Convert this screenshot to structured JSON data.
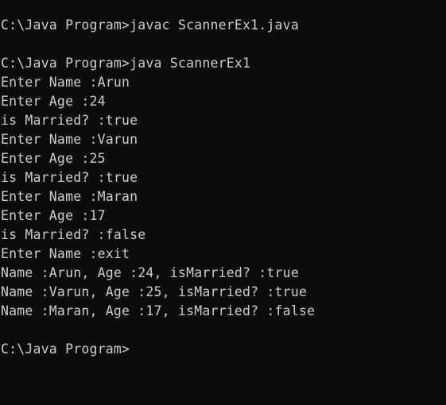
{
  "terminal": {
    "colors": {
      "background": "#0c0c0c",
      "foreground": "#cccccc"
    },
    "lines": [
      "C:\\Java Program>javac ScannerEx1.java",
      "",
      "C:\\Java Program>java ScannerEx1",
      "Enter Name :Arun",
      "Enter Age :24",
      "is Married? :true",
      "Enter Name :Varun",
      "Enter Age :25",
      "is Married? :true",
      "Enter Name :Maran",
      "Enter Age :17",
      "is Married? :false",
      "Enter Name :exit",
      "Name :Arun, Age :24, isMarried? :true",
      "Name :Varun, Age :25, isMarried? :true",
      "Name :Maran, Age :17, isMarried? :false",
      "",
      "C:\\Java Program>"
    ]
  }
}
